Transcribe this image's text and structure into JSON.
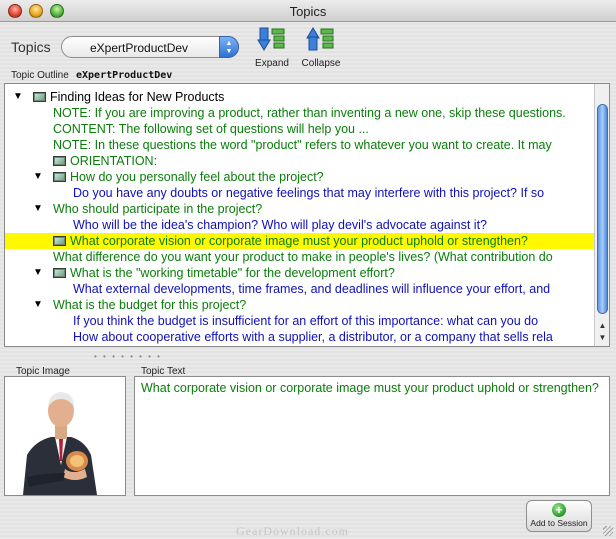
{
  "window": {
    "title": "Topics"
  },
  "toolbar": {
    "topics_label": "Topics",
    "topic_select_value": "eXpertProductDev",
    "expand_label": "Expand",
    "collapse_label": "Collapse"
  },
  "outline": {
    "caption": "Topic Outline",
    "name": "eXpertProductDev",
    "rows": [
      {
        "indent": 0,
        "triangle": "open",
        "icon": true,
        "color": "black",
        "text": "Finding Ideas for New Products"
      },
      {
        "indent": 1,
        "triangle": "",
        "icon": false,
        "color": "green",
        "text": "NOTE: If you are improving a product, rather than inventing a new one, skip these questions."
      },
      {
        "indent": 1,
        "triangle": "",
        "icon": false,
        "color": "green",
        "text": "CONTENT: The following set of questions will help you ..."
      },
      {
        "indent": 1,
        "triangle": "",
        "icon": false,
        "color": "green",
        "text": "NOTE: In these questions the word \"product\" refers to whatever you want to create. It may"
      },
      {
        "indent": 1,
        "triangle": "",
        "icon": true,
        "color": "green",
        "text": "ORIENTATION:"
      },
      {
        "indent": 1,
        "triangle": "open",
        "icon": true,
        "color": "green",
        "text": "How do you personally feel about the project?"
      },
      {
        "indent": 2,
        "triangle": "",
        "icon": false,
        "color": "blue",
        "text": "Do you have any doubts or negative feelings that may interfere with this project?  If so"
      },
      {
        "indent": 1,
        "triangle": "open",
        "icon": false,
        "color": "green",
        "text": "Who should participate in the project?"
      },
      {
        "indent": 2,
        "triangle": "",
        "icon": false,
        "color": "blue",
        "text": "Who will be the idea's champion? Who will play devil's advocate against it?"
      },
      {
        "indent": 1,
        "triangle": "",
        "icon": true,
        "color": "green",
        "text": "What corporate vision or corporate image must your product uphold or strengthen?",
        "selected": true
      },
      {
        "indent": 1,
        "triangle": "",
        "icon": false,
        "color": "green",
        "text": "What difference do you want your product to make in people's lives? (What contribution do"
      },
      {
        "indent": 1,
        "triangle": "open",
        "icon": true,
        "color": "green",
        "text": "What is the \"working timetable\" for the development effort?"
      },
      {
        "indent": 2,
        "triangle": "",
        "icon": false,
        "color": "blue",
        "text": "What external developments, time frames, and deadlines will influence your effort, and"
      },
      {
        "indent": 1,
        "triangle": "open",
        "icon": false,
        "color": "green",
        "text": "What is the budget for this project?"
      },
      {
        "indent": 2,
        "triangle": "",
        "icon": false,
        "color": "blue",
        "text": "If you think the budget is insufficient for an effort of this importance: what can you do"
      },
      {
        "indent": 2,
        "triangle": "",
        "icon": false,
        "color": "blue",
        "text": "How about cooperative efforts with a supplier, a distributor, or a company that sells rela"
      }
    ]
  },
  "topic_image": {
    "caption": "Topic Image"
  },
  "topic_text": {
    "caption": "Topic Text",
    "value": "What corporate vision or corporate image must your product uphold or strengthen?"
  },
  "add_button": {
    "label": "Add to Session"
  },
  "watermark": "GearDownload.com",
  "colors": {
    "selection": "#fff800",
    "green_text": "#0a7d0a",
    "blue_text": "#1010b8"
  }
}
